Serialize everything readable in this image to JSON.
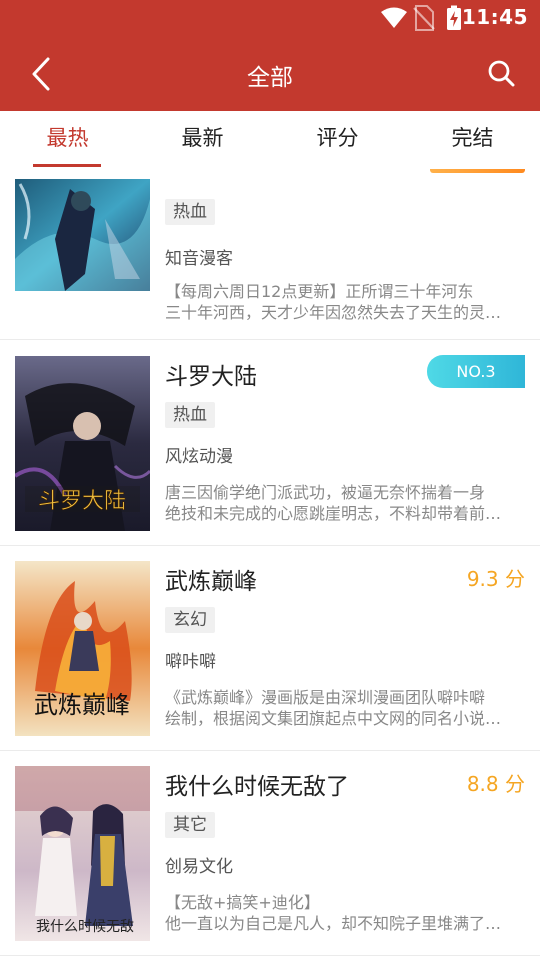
{
  "status_bar": {
    "time": "11:45"
  },
  "header": {
    "title": "全部"
  },
  "tabs": [
    {
      "label": "最热",
      "active": true
    },
    {
      "label": "最新",
      "active": false
    },
    {
      "label": "评分",
      "active": false
    },
    {
      "label": "完结",
      "active": false
    }
  ],
  "colors": {
    "primary": "#c3392e",
    "score": "#f5a623",
    "badge": "#2fb6d8"
  },
  "comics": [
    {
      "title": "",
      "tag": "热血",
      "author": "知音漫客",
      "desc_line1": "【每周六周日12点更新】正所谓三十年河东",
      "desc_line2": "三十年河西，天才少年因忽然失去了天生的灵…",
      "badge": ""
    },
    {
      "title": "斗罗大陆",
      "tag": "热血",
      "author": "风炫动漫",
      "desc_line1": "唐三因偷学绝门派武功，被逼无奈怀揣着一身",
      "desc_line2": "绝技和未完成的心愿跳崖明志，不料却带着前…",
      "badge": "NO.3"
    },
    {
      "title": "武炼巅峰",
      "tag": "玄幻",
      "author": "噼咔噼",
      "desc_line1": "《武炼巅峰》漫画版是由深圳漫画团队噼咔噼",
      "desc_line2": "绘制，根据阅文集团旗起点中文网的同名小说…",
      "score": "9.3 分"
    },
    {
      "title": "我什么时候无敌了",
      "tag": "其它",
      "author": "创易文化",
      "desc_line1": "【无敌+搞笑+迪化】",
      "desc_line2": "他一直以为自己是凡人，却不知院子里堆满了…",
      "score": "8.8 分"
    }
  ]
}
